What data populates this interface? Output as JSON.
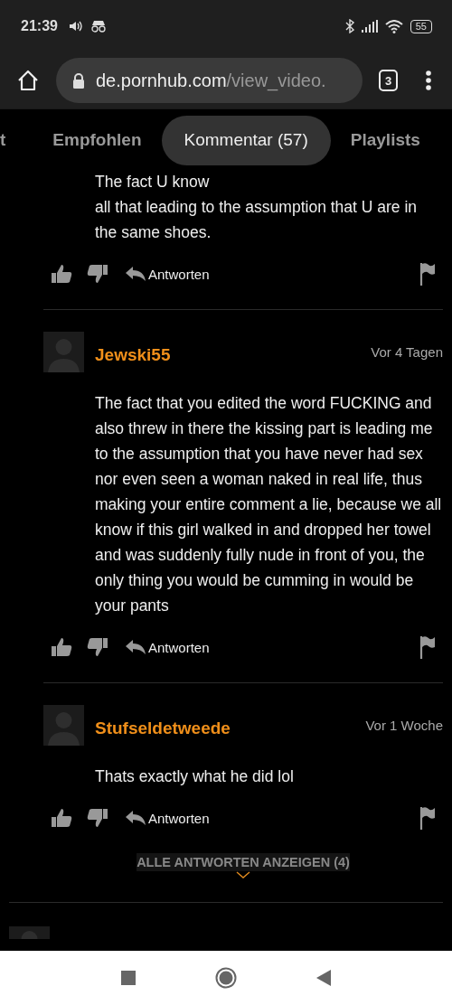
{
  "status_bar": {
    "time": "21:39",
    "battery": "55"
  },
  "browser": {
    "url_host": "de.pornhub.com",
    "url_path": "/view_video.",
    "tab_count": "3"
  },
  "tabs": [
    {
      "label": "t",
      "selected": false
    },
    {
      "label": "Empfohlen",
      "selected": false
    },
    {
      "label": "Kommentar (57)",
      "selected": true
    },
    {
      "label": "Playlists",
      "selected": false
    }
  ],
  "comments": [
    {
      "text": "The fact U know\nall that leading to the assumption that U are in the same shoes.",
      "reply_label": "Antworten"
    },
    {
      "user": "Jewski55",
      "time": "Vor 4 Tagen",
      "text": "The fact that you edited the word FUCKING and also threw in there the kissing part is leading me to the assumption that you have never had sex nor even seen a woman naked in real life, thus making your entire comment a lie, because we all know if this girl walked in and dropped her towel and was suddenly fully nude in front of you, the only thing you would be cumming in would be your pants",
      "reply_label": "Antworten"
    },
    {
      "user": "Stufseldetweede",
      "time": "Vor 1 Woche",
      "text": "Thats exactly what he did lol",
      "reply_label": "Antworten"
    }
  ],
  "show_replies": "ALLE ANTWORTEN ANZEIGEN (4)"
}
